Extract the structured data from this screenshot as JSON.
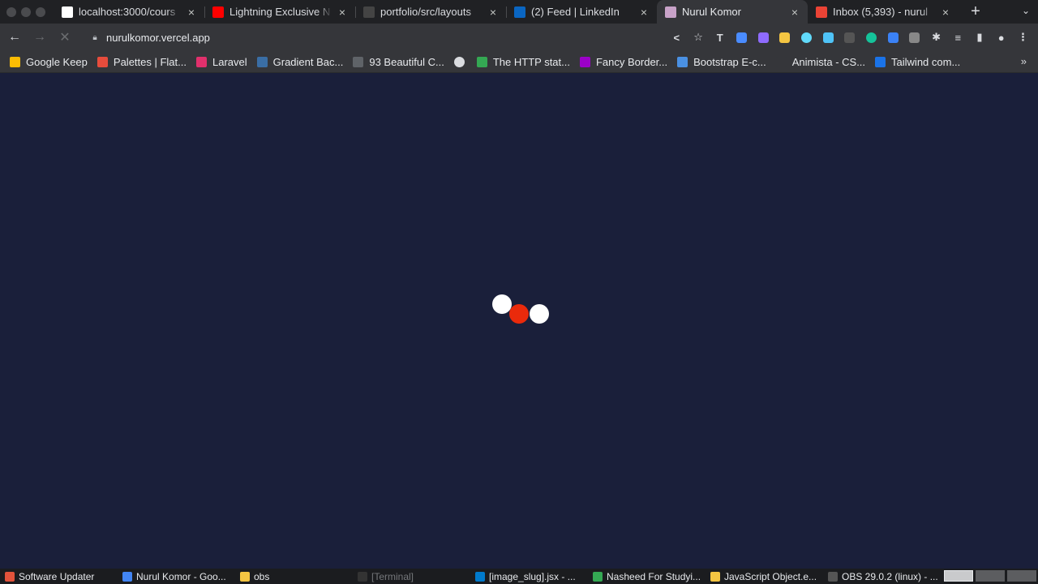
{
  "tabs": [
    {
      "title": "localhost:3000/cours",
      "favicon": "triangle-icon",
      "color": "#ffffff",
      "active": false
    },
    {
      "title": "Lightning Exclusive N",
      "favicon": "youtube-icon",
      "color": "#ff0000",
      "active": false
    },
    {
      "title": "portfolio/src/layouts",
      "favicon": "github-icon",
      "color": "#444444",
      "active": false
    },
    {
      "title": "(2) Feed | LinkedIn",
      "favicon": "linkedin-icon",
      "color": "#0a66c2",
      "active": false
    },
    {
      "title": "Nurul Komor",
      "favicon": "site-icon",
      "color": "#c8a2c8",
      "active": true
    },
    {
      "title": "Inbox (5,393) - nurul",
      "favicon": "gmail-icon",
      "color": "#ea4335",
      "active": false
    }
  ],
  "toolbar": {
    "url": "nurulkomor.vercel.app",
    "back": "←",
    "forward": "→",
    "stop": "✕",
    "extensions": [
      {
        "name": "share-icon",
        "glyph": "<",
        "color": ""
      },
      {
        "name": "star-icon",
        "glyph": "☆",
        "color": ""
      },
      {
        "name": "text-icon",
        "glyph": "T",
        "color": ""
      },
      {
        "name": "pen-ext-icon",
        "glyph": "",
        "color": "#4a8cff"
      },
      {
        "name": "feather-ext-icon",
        "glyph": "",
        "color": "#8f6bff"
      },
      {
        "name": "folder-ext-icon",
        "glyph": "",
        "color": "#f4c542"
      },
      {
        "name": "react-ext-icon",
        "glyph": "",
        "color": "#61dafb"
      },
      {
        "name": "screen-ext-icon",
        "glyph": "",
        "color": "#4fc3f7"
      },
      {
        "name": "bracket-ext-icon",
        "glyph": "",
        "color": "#555555"
      },
      {
        "name": "grammarly-ext-icon",
        "glyph": "",
        "color": "#15c39a"
      },
      {
        "name": "fi-ext-icon",
        "glyph": "",
        "color": "#3b82f6"
      },
      {
        "name": "pen-tool-ext-icon",
        "glyph": "",
        "color": "#888888"
      },
      {
        "name": "puzzle-icon",
        "glyph": "✱",
        "color": ""
      },
      {
        "name": "reading-list-icon",
        "glyph": "≡",
        "color": ""
      },
      {
        "name": "side-panel-icon",
        "glyph": "▮",
        "color": ""
      },
      {
        "name": "profile-avatar",
        "glyph": "●",
        "color": ""
      },
      {
        "name": "kebab-menu-icon",
        "glyph": "⋮",
        "color": ""
      }
    ]
  },
  "bookmarks": [
    {
      "label": "Google Keep",
      "color": "#fbbc04"
    },
    {
      "label": "Palettes | Flat...",
      "color": "#e74c3c"
    },
    {
      "label": "Laravel",
      "color": "#e1306c"
    },
    {
      "label": "Gradient Bac...",
      "color": "#3a6ea5"
    },
    {
      "label": "93 Beautiful C...",
      "color": "#5f6368"
    },
    {
      "label": "",
      "color": "#dadce0"
    },
    {
      "label": "The HTTP stat...",
      "color": "#34a853"
    },
    {
      "label": "Fancy Border...",
      "color": "#9b00c8"
    },
    {
      "label": "Bootstrap E-c...",
      "color": "#4a90e2"
    },
    {
      "label": "Animista - CS...",
      "color": "#35363a"
    },
    {
      "label": "Tailwind com...",
      "color": "#1a73e8"
    }
  ],
  "bookmarks_more": "»",
  "loader": {
    "dot_colors": [
      "#ffffff",
      "#ea2a0b",
      "#ffffff"
    ]
  },
  "taskbar": [
    {
      "label": "Software Updater",
      "color": "#e2533b",
      "dim": false
    },
    {
      "label": "Nurul Komor - Goo...",
      "color": "#4285f4",
      "dim": false
    },
    {
      "label": "obs",
      "color": "#f4c542",
      "dim": false
    },
    {
      "label": "[Terminal]",
      "color": "#333333",
      "dim": true
    },
    {
      "label": "[image_slug].jsx - ...",
      "color": "#007acc",
      "dim": false
    },
    {
      "label": "Nasheed For Studyi...",
      "color": "#34a853",
      "dim": false
    },
    {
      "label": "JavaScript Object.e...",
      "color": "#f4c542",
      "dim": false
    },
    {
      "label": "OBS 29.0.2 (linux) - ...",
      "color": "#555555",
      "dim": false
    }
  ]
}
